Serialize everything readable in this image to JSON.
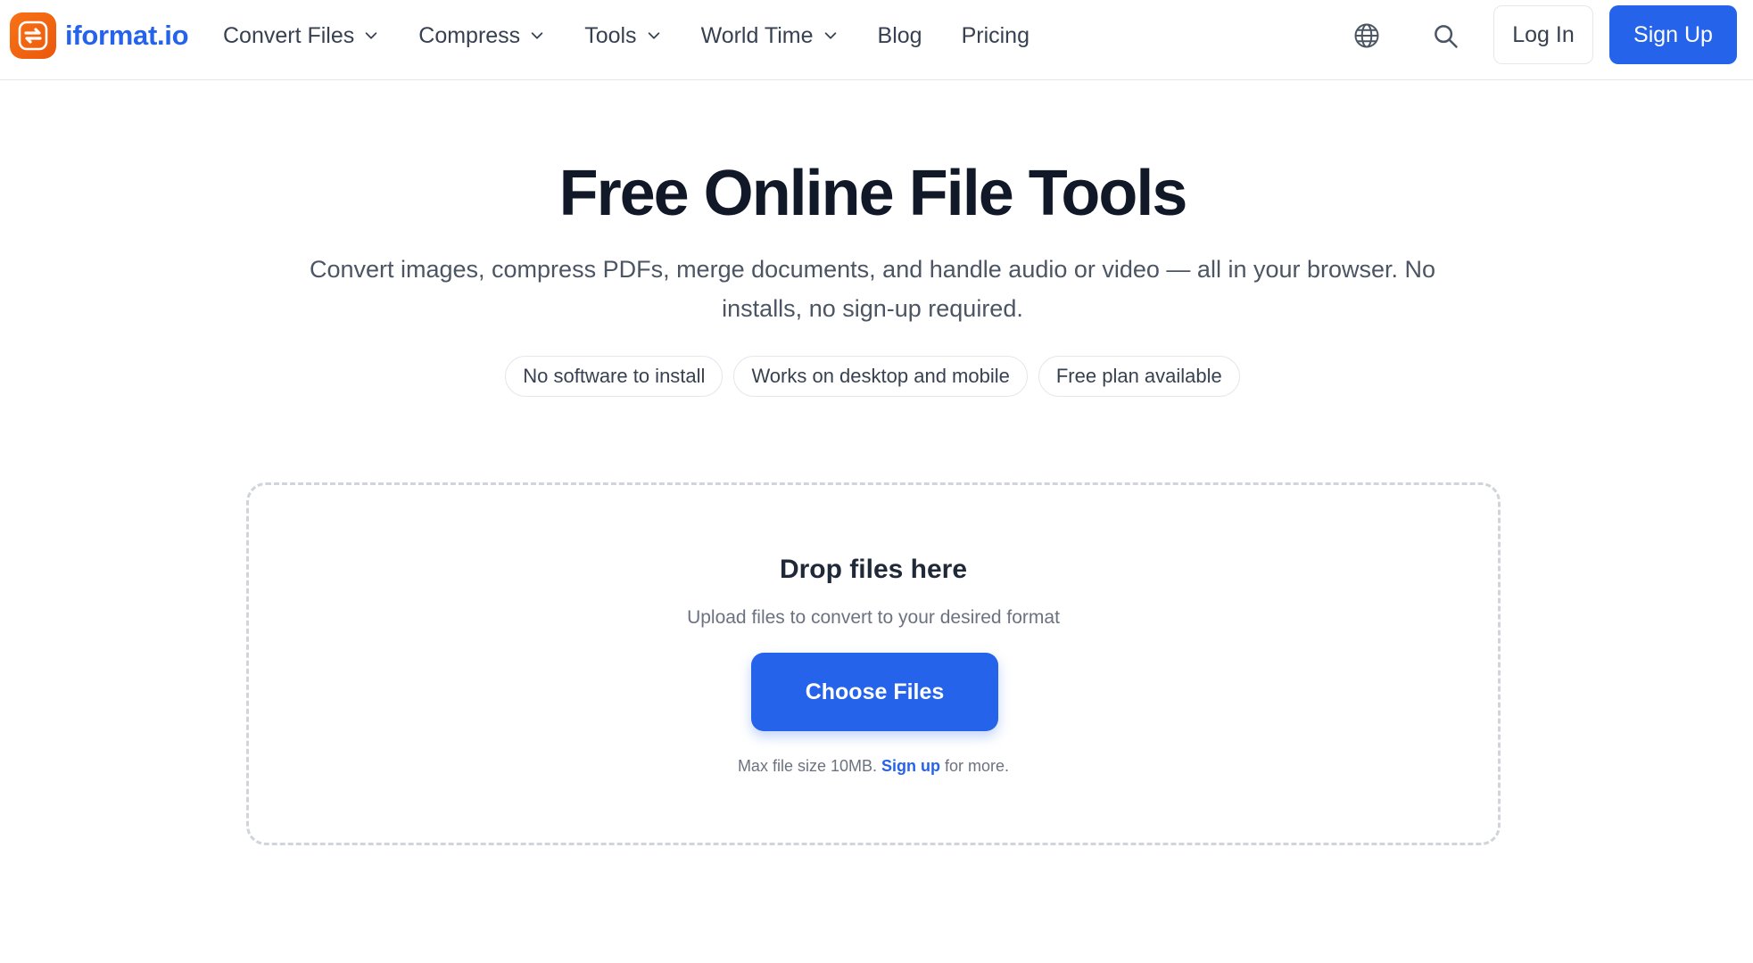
{
  "header": {
    "logo_text": "iformat.io",
    "nav": [
      {
        "label": "Convert Files",
        "has_dropdown": true
      },
      {
        "label": "Compress",
        "has_dropdown": true
      },
      {
        "label": "Tools",
        "has_dropdown": true
      },
      {
        "label": "World Time",
        "has_dropdown": true
      },
      {
        "label": "Blog",
        "has_dropdown": false
      },
      {
        "label": "Pricing",
        "has_dropdown": false
      }
    ],
    "icons": [
      "globe-icon",
      "search-icon"
    ],
    "login_label": "Log In",
    "signup_label": "Sign Up"
  },
  "hero": {
    "title": "Free Online File Tools",
    "subtitle": "Convert images, compress PDFs, merge documents, and handle audio or video — all in your browser. No installs, no sign-up required.",
    "pills": [
      "No software to install",
      "Works on desktop and mobile",
      "Free plan available"
    ]
  },
  "dropzone": {
    "title": "Drop files here",
    "subtitle": "Upload files to convert to your desired format",
    "button_label": "Choose Files",
    "note_prefix": "Max file size 10MB.",
    "note_link": "Sign up",
    "note_suffix": "for more."
  },
  "colors": {
    "accent": "#2563eb",
    "logo_orange": "#f97316",
    "text_dark": "#111827",
    "text_muted": "#6b7280",
    "border": "#e5e7eb"
  }
}
